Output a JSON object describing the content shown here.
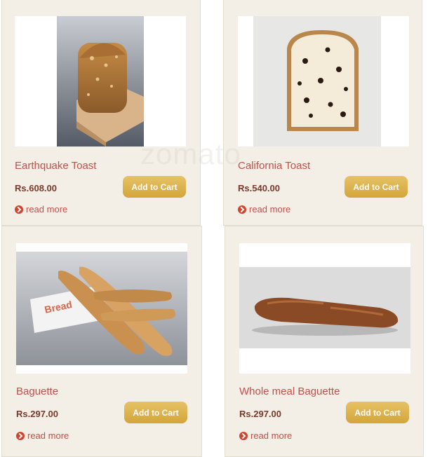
{
  "watermark": "zomato",
  "products": [
    {
      "name": "Earthquake Toast",
      "price": "Rs.608.00",
      "cart_label": "Add to Cart",
      "more_label": "read more"
    },
    {
      "name": "California Toast",
      "price": "Rs.540.00",
      "cart_label": "Add to Cart",
      "more_label": "read more"
    },
    {
      "name": "Baguette",
      "price": "Rs.297.00",
      "cart_label": "Add to Cart",
      "more_label": "read more"
    },
    {
      "name": "Whole meal Baguette",
      "price": "Rs.297.00",
      "cart_label": "Add to Cart",
      "more_label": "read more"
    }
  ],
  "colors": {
    "card_bg": "#f3efe7",
    "title": "#c0504a",
    "price": "#7a3a2a",
    "button": "#d9ae4a"
  },
  "icons": [
    "read-more-arrow-icon"
  ]
}
